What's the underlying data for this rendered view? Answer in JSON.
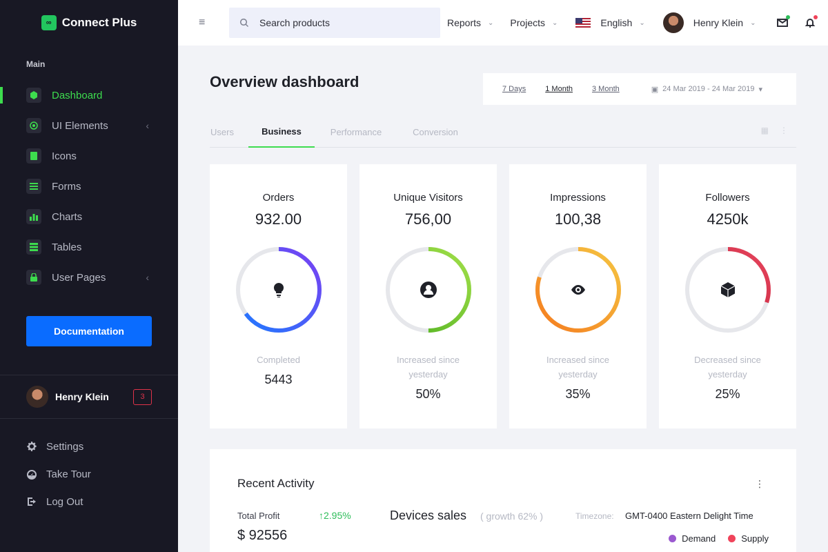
{
  "brand": {
    "name": "Connect Plus"
  },
  "sidebar": {
    "section_label": "Main",
    "items": [
      {
        "label": "Dashboard",
        "icon": "cube-icon",
        "active": true
      },
      {
        "label": "UI Elements",
        "icon": "crosshair-icon",
        "has_children": true
      },
      {
        "label": "Icons",
        "icon": "contacts-icon"
      },
      {
        "label": "Forms",
        "icon": "list-icon"
      },
      {
        "label": "Charts",
        "icon": "bar-chart-icon"
      },
      {
        "label": "Tables",
        "icon": "table-icon"
      },
      {
        "label": "User Pages",
        "icon": "lock-icon",
        "has_children": true
      }
    ],
    "doc_button": "Documentation",
    "user": {
      "name": "Henry Klein",
      "badge": "3"
    },
    "links": [
      {
        "label": "Settings",
        "icon": "gear-icon"
      },
      {
        "label": "Take Tour",
        "icon": "speedometer-icon"
      },
      {
        "label": "Log Out",
        "icon": "logout-icon"
      }
    ]
  },
  "topbar": {
    "search_placeholder": "Search products",
    "menus": [
      "Reports",
      "Projects"
    ],
    "language": "English",
    "user_name": "Henry Klein"
  },
  "main": {
    "title": "Overview dashboard",
    "ranges": [
      "7 Days",
      "1 Month",
      "3 Month"
    ],
    "selected_range": "1 Month",
    "date_range": "24 Mar 2019 - 24 Mar 2019",
    "tabs": [
      "Users",
      "Business",
      "Performance",
      "Conversion"
    ],
    "active_tab": "Business",
    "cards": [
      {
        "title": "Orders",
        "value": "932.00",
        "label": "Completed",
        "stat": "5443",
        "progress": 0.65,
        "color_a": "#1e7bff",
        "color_b": "#7b3ff2",
        "icon": "lightbulb-icon"
      },
      {
        "title": "Unique Visitors",
        "value": "756,00",
        "label": "Increased since yesterday",
        "stat": "50%",
        "progress": 0.5,
        "color_a": "#4caf1f",
        "color_b": "#a3e04a",
        "icon": "account-icon"
      },
      {
        "title": "Impressions",
        "value": "100,38",
        "label": "Increased since yesterday",
        "stat": "35%",
        "progress": 0.8,
        "color_a": "#f57c1f",
        "color_b": "#f5c542",
        "icon": "eye-icon"
      },
      {
        "title": "Followers",
        "value": "4250k",
        "label": "Decreased since yesterday",
        "stat": "25%",
        "progress": 0.3,
        "color_a": "#b3122b",
        "color_b": "#e8475f",
        "icon": "cube-icon"
      }
    ]
  },
  "activity": {
    "title": "Recent Activity",
    "total_profit_label": "Total Profit",
    "total_profit_growth": "2.95%",
    "total_profit_value": "$ 92556",
    "devices_title": "Devices sales",
    "devices_growth": "( growth 62% )",
    "timezone_label": "Timezone:",
    "timezone_value": "GMT-0400 Eastern Delight Time",
    "legend": [
      {
        "label": "Demand",
        "color": "#9b59d0"
      },
      {
        "label": "Supply",
        "color": "#f0435a"
      }
    ]
  }
}
